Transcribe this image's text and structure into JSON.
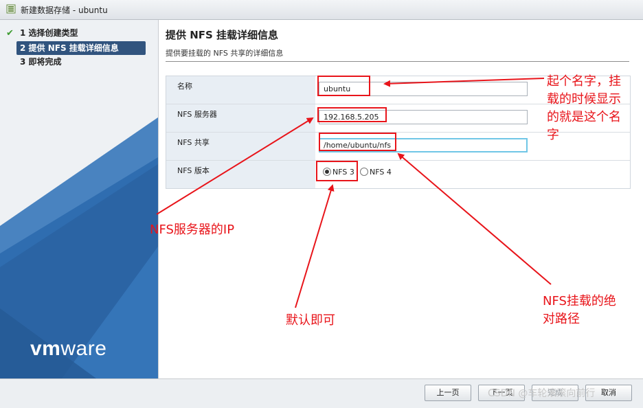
{
  "window": {
    "title": "新建数据存储 - ubuntu"
  },
  "steps": [
    {
      "label": "1 选择创建类型",
      "state": "done"
    },
    {
      "label": "2 提供 NFS 挂载详细信息",
      "state": "active"
    },
    {
      "label": "3 即将完成",
      "state": "pending"
    }
  ],
  "brand": {
    "logo_bold": "vm",
    "logo_light": "ware"
  },
  "page": {
    "title": "提供 NFS 挂载详细信息",
    "subtitle": "提供要挂载的 NFS 共享的详细信息"
  },
  "form": {
    "name_label": "名称",
    "name_value": "ubuntu",
    "server_label": "NFS 服务器",
    "server_value": "192.168.5.205",
    "share_label": "NFS 共享",
    "share_value": "/home/ubuntu/nfs",
    "version_label": "NFS 版本",
    "version_options": [
      {
        "label": "NFS 3",
        "selected": true
      },
      {
        "label": "NFS 4",
        "selected": false
      }
    ]
  },
  "annotations": {
    "name_note": "起个名字，挂载的时候显示的就是这个名字",
    "name_note_lines": [
      "起个名字，挂",
      "载的时候显示",
      "的就是这个名",
      "字"
    ],
    "server_note": "NFS服务器的IP",
    "version_note": "默认即可",
    "share_note_lines": [
      "NFS挂载的绝",
      "对路径"
    ]
  },
  "footer": {
    "back": "上一页",
    "next": "下一页",
    "finish": "完成",
    "cancel": "取消"
  },
  "watermark": "CSDN @车轮滚滚向前行",
  "colors": {
    "accent": "#31547e",
    "annotation": "#e8141a",
    "brand_blue": "#2f6db0"
  }
}
